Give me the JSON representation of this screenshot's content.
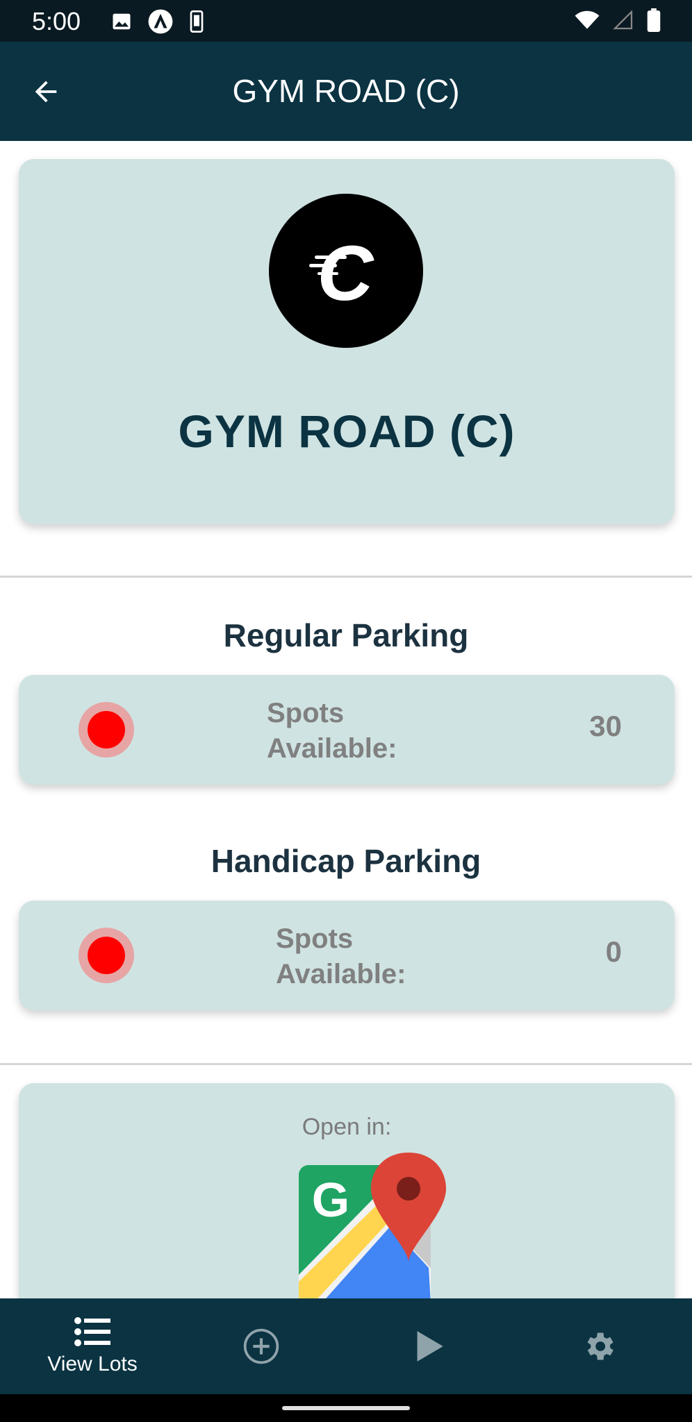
{
  "status_bar": {
    "time": "5:00",
    "icons_left": [
      "image-icon",
      "app-a-icon",
      "phone-icon"
    ],
    "icons_right": [
      "wifi-icon",
      "signal-icon",
      "battery-icon"
    ]
  },
  "app_bar": {
    "title": "GYM ROAD (C)",
    "back_icon": "arrow-left-icon"
  },
  "hero": {
    "logo_letter": "C",
    "title": "GYM ROAD (C)"
  },
  "regular": {
    "heading": "Regular Parking",
    "label": "Spots Available:",
    "value": "30",
    "status_color": "#ff0000"
  },
  "handicap": {
    "heading": "Handicap Parking",
    "label": "Spots Available:",
    "value": "0",
    "status_color": "#ff0000"
  },
  "open_in": {
    "label": "Open in:",
    "app_icon": "google-maps-icon"
  },
  "bottom_nav": {
    "items": [
      {
        "label": "View Lots",
        "icon": "list-icon",
        "active": true
      },
      {
        "label": "",
        "icon": "add-circle-icon",
        "active": false
      },
      {
        "label": "",
        "icon": "play-icon",
        "active": false
      },
      {
        "label": "",
        "icon": "gear-icon",
        "active": false
      }
    ]
  },
  "colors": {
    "app_bar": "#0b3342",
    "card": "#cfe3e2",
    "status_red": "#ff0000"
  }
}
